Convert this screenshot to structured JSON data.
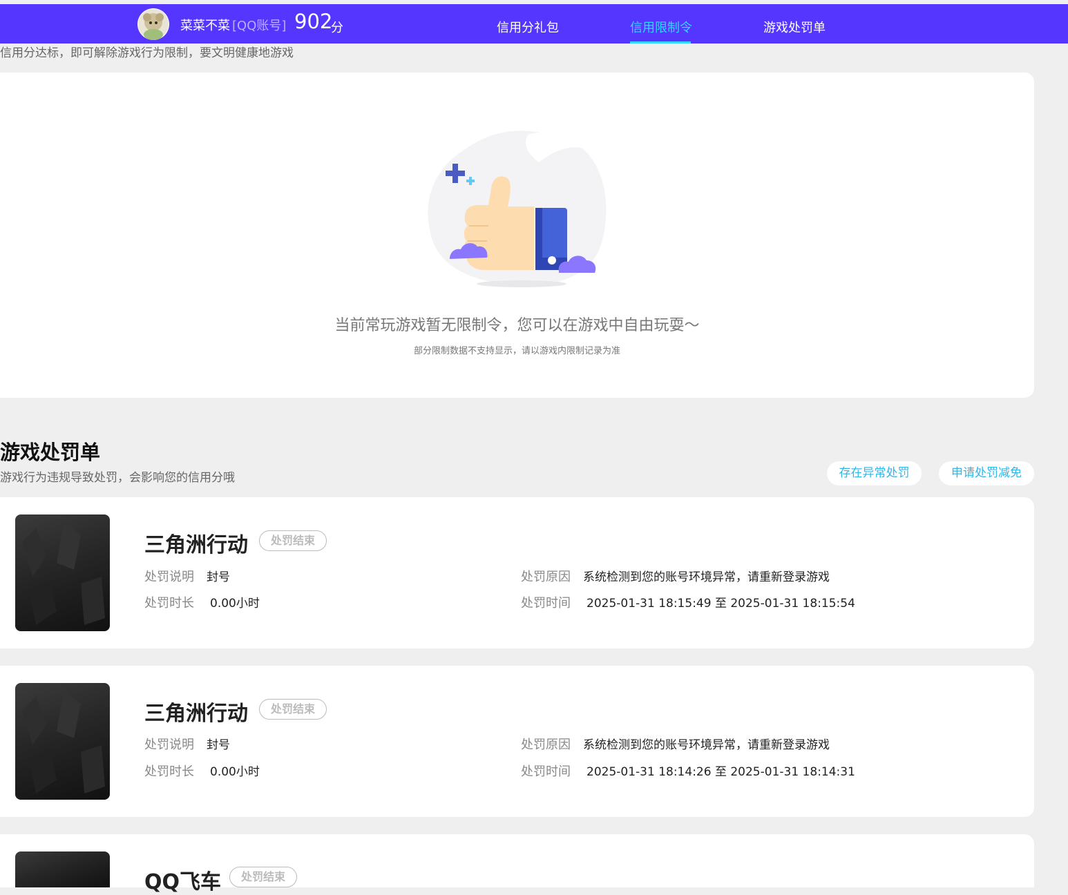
{
  "header": {
    "nickname": "菜菜不菜",
    "account_type": "[QQ账号]",
    "score": "902",
    "score_unit": "分",
    "tabs": [
      {
        "label": "信用分礼包",
        "active": false
      },
      {
        "label": "信用限制令",
        "active": true
      },
      {
        "label": "游戏处罚单",
        "active": false
      }
    ]
  },
  "restriction": {
    "subtitle": "信用分达标，即可解除游戏行为限制，要文明健康地游戏",
    "empty_text": "当前常玩游戏暂无限制令，您可以在游戏中自由玩耍～",
    "empty_note": "部分限制数据不支持显示，请以游戏内限制记录为准"
  },
  "penalty": {
    "title": "游戏处罚单",
    "subtitle": "游戏行为违规导致处罚，会影响您的信用分哦",
    "btn_abnormal": "存在异常处罚",
    "btn_appeal": "申请处罚减免",
    "labels": {
      "desc": "处罚说明",
      "reason": "处罚原因",
      "duration": "处罚时长",
      "time": "处罚时间"
    },
    "items": [
      {
        "game": "三角洲行动",
        "status": "处罚结束",
        "desc": "封号",
        "reason": "系统检测到您的账号环境异常，请重新登录游戏",
        "duration": "0.00小时",
        "time": "2025-01-31 18:15:49 至 2025-01-31 18:15:54"
      },
      {
        "game": "三角洲行动",
        "status": "处罚结束",
        "desc": "封号",
        "reason": "系统检测到您的账号环境异常，请重新登录游戏",
        "duration": "0.00小时",
        "time": "2025-01-31 18:14:26 至 2025-01-31 18:14:31"
      },
      {
        "game": "QQ飞车",
        "status": "处罚结束"
      }
    ]
  },
  "colors": {
    "nav_bg": "#5436ff",
    "accent_cyan": "#31d8ff",
    "link_blue": "#2fb6e9",
    "page_bg": "#efefef"
  }
}
